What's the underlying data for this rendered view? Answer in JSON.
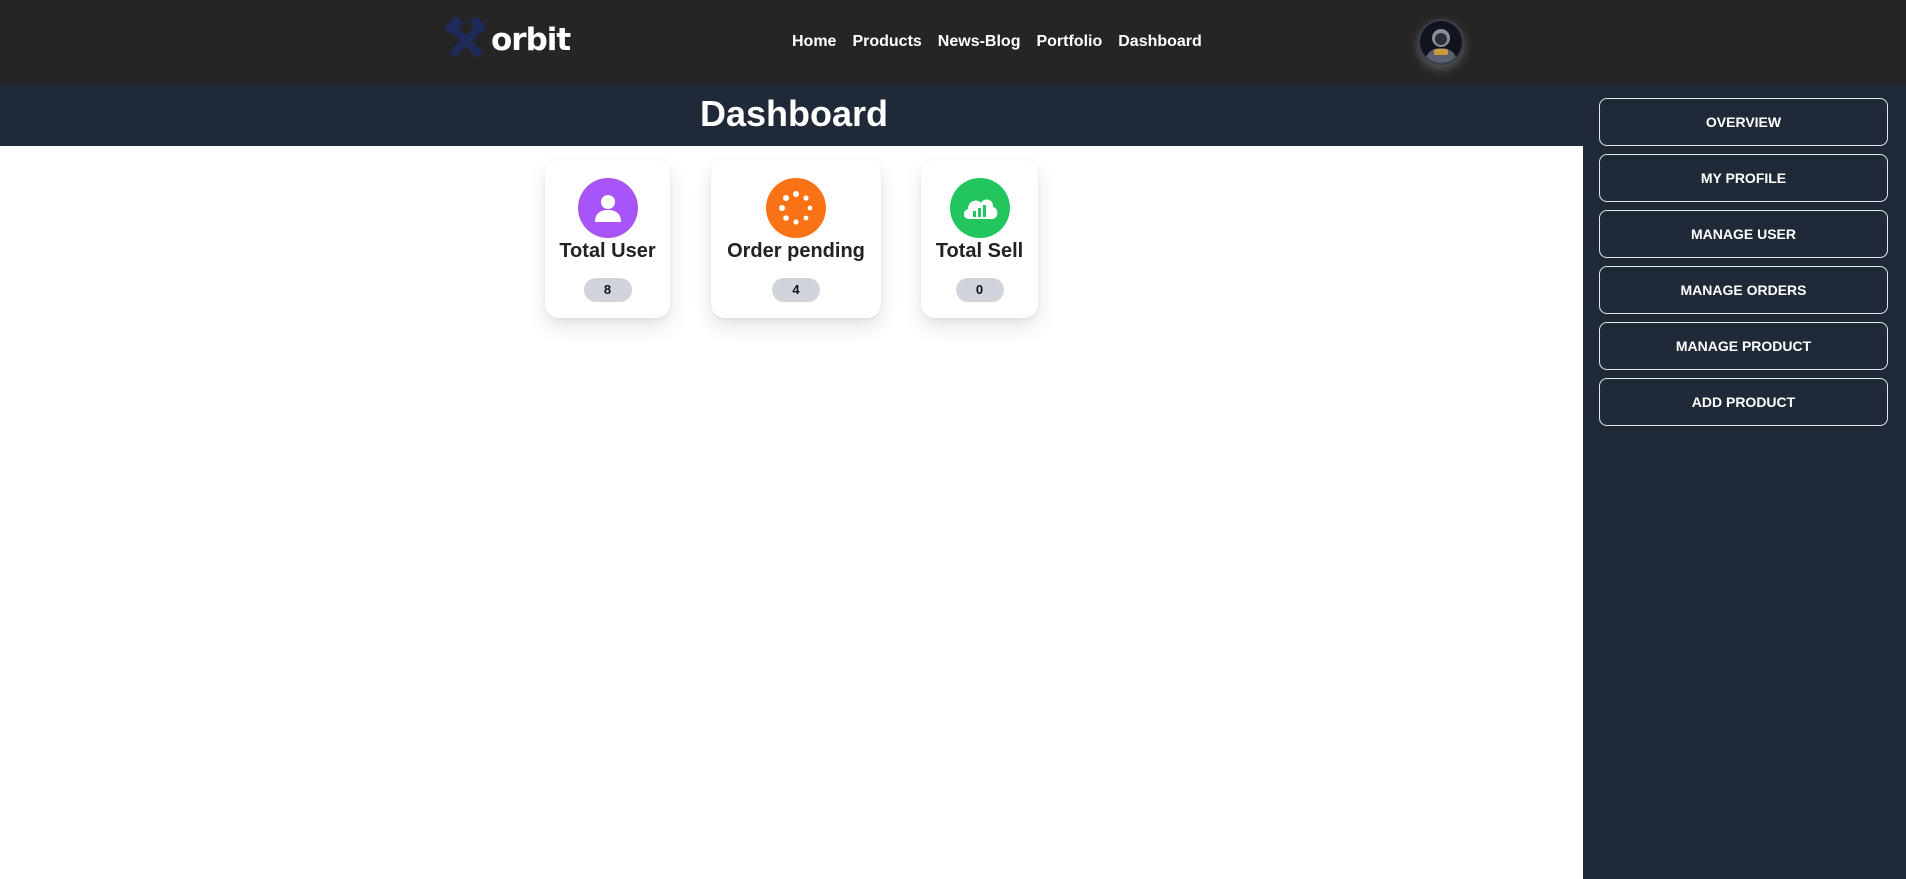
{
  "header": {
    "logo_text": "orbit",
    "nav": [
      {
        "label": "Home"
      },
      {
        "label": "Products"
      },
      {
        "label": "News-Blog"
      },
      {
        "label": "Portfolio"
      },
      {
        "label": "Dashboard"
      }
    ],
    "avatar_icon": "user-avatar"
  },
  "page": {
    "title": "Dashboard"
  },
  "stats": [
    {
      "label": "Total User",
      "value": "8",
      "icon": "user-icon",
      "color": "#a855f7"
    },
    {
      "label": "Order pending",
      "value": "4",
      "icon": "spinner-icon",
      "color": "#f97316"
    },
    {
      "label": "Total Sell",
      "value": "0",
      "icon": "cloud-chart-icon",
      "color": "#22c55e"
    }
  ],
  "sidebar": {
    "items": [
      {
        "label": "OVERVIEW"
      },
      {
        "label": "MY PROFILE"
      },
      {
        "label": "MANAGE USER"
      },
      {
        "label": "MANAGE ORDERS"
      },
      {
        "label": "MANAGE PRODUCT"
      },
      {
        "label": "ADD PRODUCT"
      }
    ]
  },
  "colors": {
    "navbar_bg": "#252525",
    "panel_bg": "#1f2937",
    "logo_icon": "#1e2a5a"
  }
}
